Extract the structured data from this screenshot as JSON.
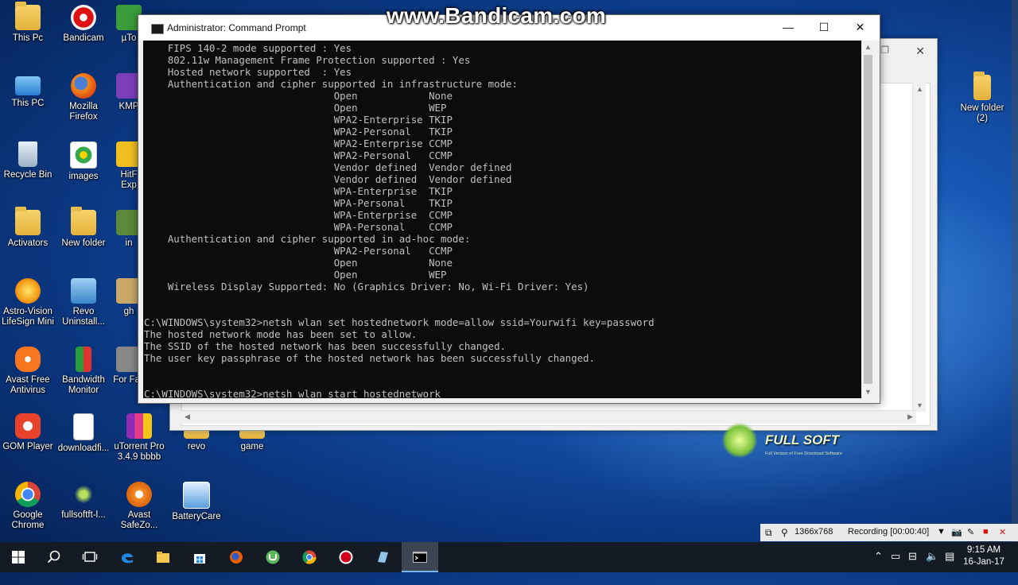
{
  "watermark": "www.Bandicam.com",
  "fullsoft": {
    "title": "FULL SOFT",
    "tagline": "Full Version of Free Download Software"
  },
  "desktop_icons": [
    {
      "label": "This Pc"
    },
    {
      "label": "Bandicam"
    },
    {
      "label": "µTo"
    },
    {
      "label": "This PC"
    },
    {
      "label": "Mozilla Firefox"
    },
    {
      "label": "KMP"
    },
    {
      "label": "Recycle Bin"
    },
    {
      "label": "images"
    },
    {
      "label": "HitF Exp"
    },
    {
      "label": "Activators"
    },
    {
      "label": "New folder"
    },
    {
      "label": "in"
    },
    {
      "label": "Astro-Vision LifeSign Mini"
    },
    {
      "label": "Revo Uninstall..."
    },
    {
      "label": "gh"
    },
    {
      "label": "Avast Free Antivirus"
    },
    {
      "label": "Bandwidth Monitor"
    },
    {
      "label": "For Fac"
    },
    {
      "label": "GOM Player"
    },
    {
      "label": "downloadfi..."
    },
    {
      "label": "uTorrent Pro 3.4.9 bbbb"
    },
    {
      "label": "revo"
    },
    {
      "label": "game"
    },
    {
      "label": "Google Chrome"
    },
    {
      "label": "fullsoftft-l..."
    },
    {
      "label": "Avast SafeZo..."
    },
    {
      "label": "BatteryCare"
    },
    {
      "label": "New folder (2)"
    }
  ],
  "cmd": {
    "title": "Administrator: Command Prompt",
    "lines": [
      "    FIPS 140-2 mode supported : Yes",
      "    802.11w Management Frame Protection supported : Yes",
      "    Hosted network supported  : Yes",
      "    Authentication and cipher supported in infrastructure mode:",
      "                                Open            None",
      "                                Open            WEP",
      "                                WPA2-Enterprise TKIP",
      "                                WPA2-Personal   TKIP",
      "                                WPA2-Enterprise CCMP",
      "                                WPA2-Personal   CCMP",
      "                                Vendor defined  Vendor defined",
      "                                Vendor defined  Vendor defined",
      "                                WPA-Enterprise  TKIP",
      "                                WPA-Personal    TKIP",
      "                                WPA-Enterprise  CCMP",
      "                                WPA-Personal    CCMP",
      "    Authentication and cipher supported in ad-hoc mode:",
      "                                WPA2-Personal   CCMP",
      "                                Open            None",
      "                                Open            WEP",
      "    Wireless Display Supported: No (Graphics Driver: No, Wi-Fi Driver: Yes)",
      "",
      "",
      "C:\\WINDOWS\\system32>netsh wlan set hostednetwork mode=allow ssid=Yourwifi key=password",
      "The hosted network mode has been set to allow.",
      "The SSID of the hosted network has been successfully changed.",
      "The user key passphrase of the hosted network has been successfully changed.",
      "",
      "",
      "C:\\WINDOWS\\system32>netsh wlan start hostednetwork"
    ]
  },
  "recording": {
    "resolution": "1366x768",
    "status": "Recording [00:00:40]"
  },
  "clock": {
    "time": "9:15 AM",
    "date": "16-Jan-17"
  },
  "colors": {
    "taskbar": "#151b24",
    "terminal_bg": "#0c0c0c",
    "terminal_fg": "#c0c0c0",
    "close_red": "#e81123"
  }
}
